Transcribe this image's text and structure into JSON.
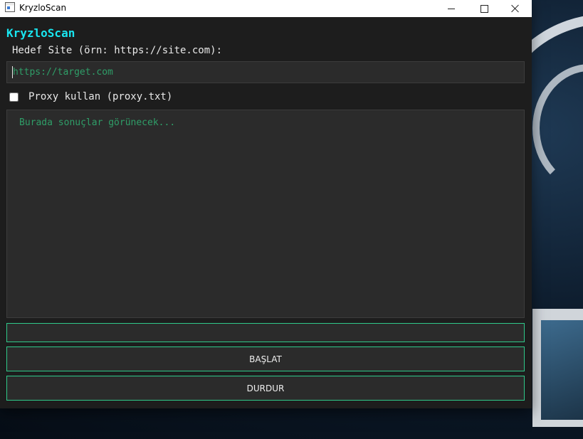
{
  "window": {
    "title": "KryzloScan"
  },
  "app": {
    "heading": "KryzloScan",
    "site_label": "Hedef Site (örn: https://site.com):",
    "url_placeholder": "https://target.com",
    "url_value": "",
    "proxy_label": "Proxy kullan (proxy.txt)",
    "proxy_checked": false,
    "results_placeholder": "Burada sonuçlar görünecek...",
    "progress_percent": 0,
    "start_label": "BAŞLAT",
    "stop_label": "DURDUR"
  },
  "colors": {
    "accent": "#2fc98a",
    "title": "#19e6f0",
    "placeholder": "#2f9e68",
    "background": "#1d1d1d",
    "field": "#2b2b2b"
  },
  "icons": {
    "app": "app-window-icon",
    "minimize": "minimize-icon",
    "maximize": "maximize-icon",
    "close": "close-icon"
  }
}
